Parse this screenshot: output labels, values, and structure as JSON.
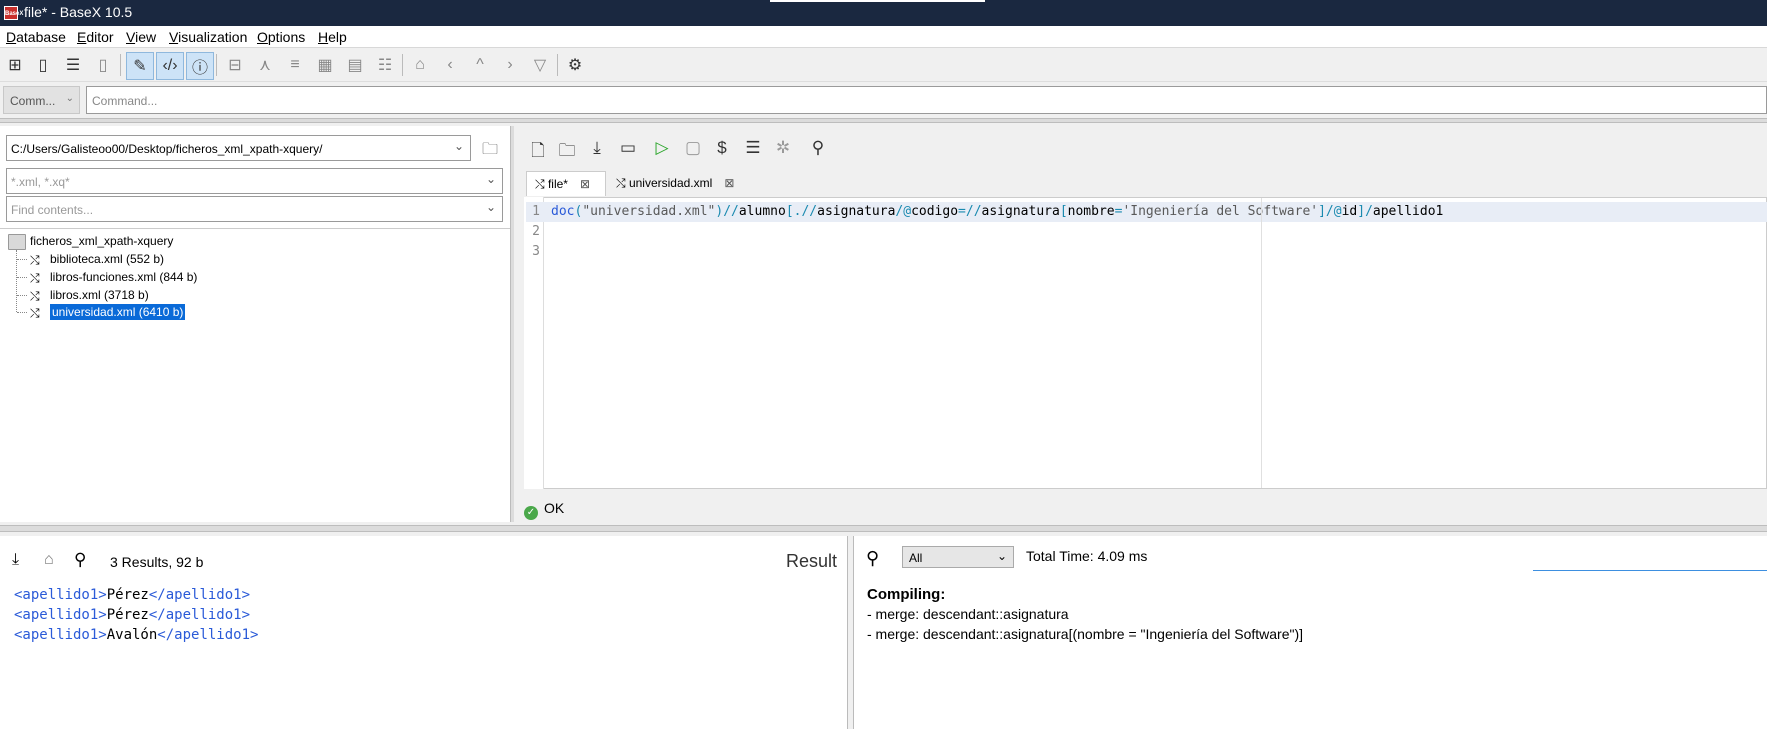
{
  "window": {
    "title": "file* - BaseX 10.5",
    "app_icon_text": "BaseX"
  },
  "menu": [
    "Database",
    "Editor",
    "View",
    "Visualization",
    "Options",
    "Help"
  ],
  "toolbar": {
    "buttons": [
      {
        "icon": "new-database-icon"
      },
      {
        "icon": "open-database-icon"
      },
      {
        "icon": "properties-icon"
      },
      {
        "icon": "close-database-icon"
      },
      {
        "icon": "editor-toggle-icon"
      },
      {
        "icon": "xquery-code-icon"
      },
      {
        "icon": "info-icon"
      },
      {
        "icon": "map-view-icon"
      },
      {
        "icon": "tree-view-icon"
      },
      {
        "icon": "folder-view-icon"
      },
      {
        "icon": "plot-view-icon"
      },
      {
        "icon": "table-view-icon"
      },
      {
        "icon": "text-view-icon"
      },
      {
        "icon": "home-icon"
      },
      {
        "icon": "back-icon"
      },
      {
        "icon": "up-icon"
      },
      {
        "icon": "forward-icon"
      },
      {
        "icon": "filter-icon"
      },
      {
        "icon": "settings-icon"
      }
    ]
  },
  "command": {
    "mode": "Comm...",
    "placeholder": "Command..."
  },
  "project": {
    "path": "C:/Users/Galisteoo00/Desktop/ficheros_xml_xpath-xquery/",
    "filter_placeholder": "*.xml, *.xq*",
    "contents_placeholder": "Find contents...",
    "root_folder": "ficheros_xml_xpath-xquery",
    "files": [
      {
        "label": "biblioteca.xml (552 b)",
        "selected": false
      },
      {
        "label": "libros-funciones.xml (844 b)",
        "selected": false
      },
      {
        "label": "libros.xml (3718 b)",
        "selected": false
      },
      {
        "label": "universidad.xml (6410 b)",
        "selected": true
      }
    ]
  },
  "editor": {
    "tabs": [
      {
        "label": "file*",
        "active": true
      },
      {
        "label": "universidad.xml",
        "active": false
      }
    ],
    "line_numbers": [
      "1",
      "2",
      "3"
    ],
    "code_tokens": [
      {
        "t": "doc",
        "c": "c-fn"
      },
      {
        "t": "(",
        "c": "c-op"
      },
      {
        "t": "\"universidad.xml\"",
        "c": "c-str"
      },
      {
        "t": ")//",
        "c": "c-op"
      },
      {
        "t": "alumno",
        "c": "c-el"
      },
      {
        "t": "[",
        "c": "c-op"
      },
      {
        "t": ".//",
        "c": "c-op"
      },
      {
        "t": "asignatura",
        "c": "c-el"
      },
      {
        "t": "/@",
        "c": "c-op"
      },
      {
        "t": "codigo",
        "c": "c-el"
      },
      {
        "t": "=//",
        "c": "c-op"
      },
      {
        "t": "asignatura",
        "c": "c-el"
      },
      {
        "t": "[",
        "c": "c-op"
      },
      {
        "t": "nombre",
        "c": "c-el"
      },
      {
        "t": "=",
        "c": "c-op"
      },
      {
        "t": "'Ingeniería del Software'",
        "c": "c-str"
      },
      {
        "t": "]/@",
        "c": "c-op"
      },
      {
        "t": "id",
        "c": "c-el"
      },
      {
        "t": "]/",
        "c": "c-op"
      },
      {
        "t": "apellido1",
        "c": "c-el"
      }
    ],
    "status": "OK"
  },
  "result": {
    "summary": "3 Results, 92 b",
    "title": "Result",
    "rows": [
      {
        "open": "<apellido1>",
        "value": "Pérez",
        "close": "</apellido1>"
      },
      {
        "open": "<apellido1>",
        "value": "Pérez",
        "close": "</apellido1>"
      },
      {
        "open": "<apellido1>",
        "value": "Avalón",
        "close": "</apellido1>"
      }
    ]
  },
  "info": {
    "filter": "All",
    "total_time": "Total Time: 4.09 ms",
    "heading": "Compiling:",
    "lines": [
      "- merge: descendant::asignatura",
      "- merge: descendant::asignatura[(nombre = \"Ingeniería del Software\")]"
    ]
  }
}
